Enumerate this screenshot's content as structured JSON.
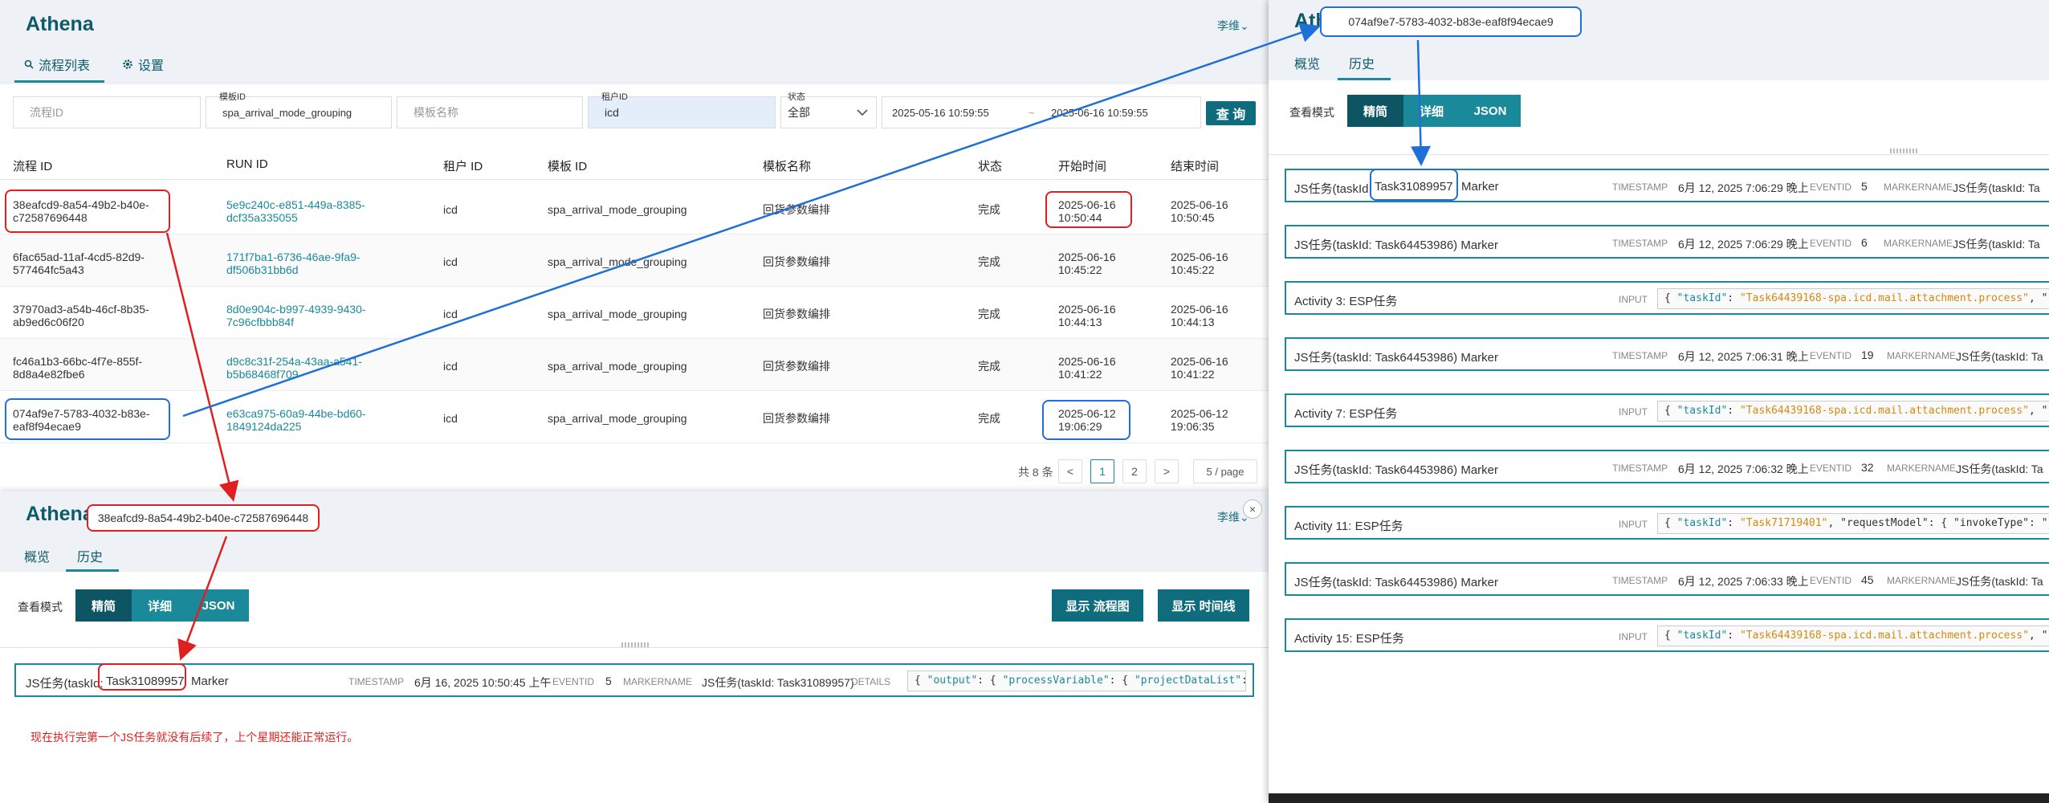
{
  "app": {
    "brand": "Athena",
    "user": "李维",
    "user_caret": "⌄"
  },
  "list_panel": {
    "tabs": [
      {
        "icon": "search-icon",
        "label": "流程列表"
      },
      {
        "icon": "gear-icon",
        "label": "设置"
      }
    ],
    "filters": {
      "flow_id_placeholder": "流程ID",
      "template_id_label": "模板ID",
      "template_id_value": "spa_arrival_mode_grouping",
      "template_name_placeholder": "模板名称",
      "tenant_id_label": "租户ID",
      "tenant_id_value": "icd",
      "status_label": "状态",
      "status_value": "全部",
      "start_time": "2025-05-16 10:59:55",
      "range_sep": "~",
      "end_time": "2025-06-16 10:59:55",
      "query_button": "查 询"
    },
    "columns": [
      "流程 ID",
      "RUN ID",
      "租户 ID",
      "模板 ID",
      "模板名称",
      "状态",
      "开始时间",
      "结束时间"
    ],
    "rows": [
      {
        "flow_id_1": "38eafcd9-8a54-49b2-b40e-",
        "flow_id_2": "c72587696448",
        "run_id_1": "5e9c240c-e851-449a-8385-",
        "run_id_2": "dcf35a335055",
        "tenant": "icd",
        "template_id": "spa_arrival_mode_grouping",
        "template_name": "回货参数编排",
        "status": "完成",
        "start_1": "2025-06-16",
        "start_2": "10:50:44",
        "end_1": "2025-06-16",
        "end_2": "10:50:45"
      },
      {
        "flow_id_1": "6fac65ad-11af-4cd5-82d9-",
        "flow_id_2": "577464fc5a43",
        "run_id_1": "171f7ba1-6736-46ae-9fa9-",
        "run_id_2": "df506b31bb6d",
        "tenant": "icd",
        "template_id": "spa_arrival_mode_grouping",
        "template_name": "回货参数编排",
        "status": "完成",
        "start_1": "2025-06-16",
        "start_2": "10:45:22",
        "end_1": "2025-06-16",
        "end_2": "10:45:22"
      },
      {
        "flow_id_1": "37970ad3-a54b-46cf-8b35-",
        "flow_id_2": "ab9ed6c06f20",
        "run_id_1": "8d0e904c-b997-4939-9430-",
        "run_id_2": "7c96cfbbb84f",
        "tenant": "icd",
        "template_id": "spa_arrival_mode_grouping",
        "template_name": "回货参数编排",
        "status": "完成",
        "start_1": "2025-06-16",
        "start_2": "10:44:13",
        "end_1": "2025-06-16",
        "end_2": "10:44:13"
      },
      {
        "flow_id_1": "fc46a1b3-66bc-4f7e-855f-",
        "flow_id_2": "8d8a4e82fbe6",
        "run_id_1": "d9c8c31f-254a-43aa-a541-",
        "run_id_2": "b5b68468f709",
        "tenant": "icd",
        "template_id": "spa_arrival_mode_grouping",
        "template_name": "回货参数编排",
        "status": "完成",
        "start_1": "2025-06-16",
        "start_2": "10:41:22",
        "end_1": "2025-06-16",
        "end_2": "10:41:22"
      },
      {
        "flow_id_1": "074af9e7-5783-4032-b83e-",
        "flow_id_2": "eaf8f94ecae9",
        "run_id_1": "e63ca975-60a9-44be-bd60-",
        "run_id_2": "1849124da225",
        "tenant": "icd",
        "template_id": "spa_arrival_mode_grouping",
        "template_name": "回货参数编排",
        "status": "完成",
        "start_1": "2025-06-12",
        "start_2": "19:06:29",
        "end_1": "2025-06-12",
        "end_2": "19:06:35"
      }
    ],
    "pagination": {
      "total": "共 8 条",
      "prev": "<",
      "page1": "1",
      "page2": "2",
      "next": ">",
      "page_size": "5 / page"
    }
  },
  "detail_left": {
    "flow_id": "38eafcd9-8a54-49b2-b40e-c72587696448",
    "tabs": [
      "概览",
      "历史"
    ],
    "view_mode_label": "查看模式",
    "modes": [
      "精简",
      "详细",
      "JSON"
    ],
    "btn_flowchart": "显示 流程图",
    "btn_timeline": "显示 时间线",
    "close": "×",
    "event": {
      "title_pre": "JS任务(taskId:",
      "title_task": "Task31089957",
      "title_post": "Marker",
      "ts_key": "TIMESTAMP",
      "ts_val": "6月 16, 2025 10:50:45 上午",
      "eid_key": "EVENTID",
      "eid_val": "5",
      "mn_key": "MARKERNAME",
      "mn_val": "JS任务(taskId: Task31089957)",
      "details_key": "DETAILS",
      "json_k1": "\"output\"",
      "json_k2": "\"processVariable\"",
      "json_k3": "\"projectDataList\""
    },
    "note": "现在执行完第一个JS任务就没有后续了，上个星期还能正常运行。"
  },
  "detail_right": {
    "flow_id": "074af9e7-5783-4032-b83e-eaf8f94ecae9",
    "tabs": [
      "概览",
      "历史"
    ],
    "view_mode_label": "查看模式",
    "modes": [
      "精简",
      "详细",
      "JSON"
    ],
    "events": [
      {
        "type": "marker",
        "title_pre": "JS任务(taskId:",
        "title_task": "Task31089957",
        "title_post": "Marker",
        "ts": "6月 12, 2025 7:06:29 晚上",
        "eid": "5",
        "mn": "JS任务(taskId: Ta"
      },
      {
        "type": "marker",
        "title": "JS任务(taskId: Task64453986) Marker",
        "ts": "6月 12, 2025 7:06:29 晚上",
        "eid": "6",
        "mn": "JS任务(taskId: Ta"
      },
      {
        "type": "activity",
        "title": "Activity 3: ESP任务",
        "k1": "\"taskId\"",
        "v1": "\"Task64439168-spa.icd.mail.attachment.process\"",
        "rest": ", \"re"
      },
      {
        "type": "marker",
        "title": "JS任务(taskId: Task64453986) Marker",
        "ts": "6月 12, 2025 7:06:31 晚上",
        "eid": "19",
        "mn": "JS任务(taskId: Ta"
      },
      {
        "type": "activity",
        "title": "Activity 7: ESP任务",
        "k1": "\"taskId\"",
        "v1": "\"Task64439168-spa.icd.mail.attachment.process\"",
        "rest": ", \"re"
      },
      {
        "type": "marker",
        "title": "JS任务(taskId: Task64453986) Marker",
        "ts": "6月 12, 2025 7:06:32 晚上",
        "eid": "32",
        "mn": "JS任务(taskId: Ta"
      },
      {
        "type": "activity",
        "title": "Activity 11: ESP任务",
        "k1": "\"taskId\"",
        "v1": "\"Task71719401\"",
        "rest": ", \"requestModel\": { \"invokeType\": \"FA"
      },
      {
        "type": "marker",
        "title": "JS任务(taskId: Task64453986) Marker",
        "ts": "6月 12, 2025 7:06:33 晚上",
        "eid": "45",
        "mn": "JS任务(taskId: Ta"
      },
      {
        "type": "activity",
        "title": "Activity 15: ESP任务",
        "k1": "\"taskId\"",
        "v1": "\"Task64439168-spa.icd.mail.attachment.process\"",
        "rest": ", \"re"
      }
    ],
    "labels": {
      "ts": "TIMESTAMP",
      "eid": "EVENTID",
      "mn": "MARKERNAME",
      "input": "INPUT"
    }
  },
  "colors": {
    "brand": "#0f5a6a",
    "accent": "#1a8a9a",
    "button_dark": "#0f6c7d",
    "annotation_red": "#e02020",
    "annotation_blue": "#1f6fd6"
  }
}
